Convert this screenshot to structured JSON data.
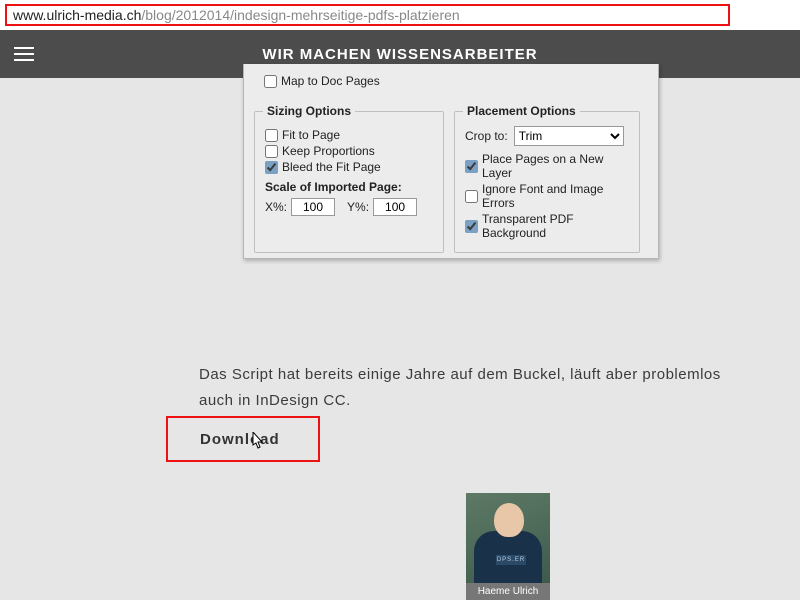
{
  "url": {
    "domain": "www.ulrich-media.ch",
    "path": "/blog/2012014/indesign-mehrseitige-pdfs-platzieren"
  },
  "header": {
    "title": "WIR MACHEN WISSENSARBEITER"
  },
  "dialog": {
    "map_to_doc_pages": {
      "label": "Map to Doc Pages",
      "checked": false
    },
    "sizing": {
      "legend": "Sizing Options",
      "fit_to_page": {
        "label": "Fit to Page",
        "checked": false
      },
      "keep_proportions": {
        "label": "Keep Proportions",
        "checked": false
      },
      "bleed_fit_page": {
        "label": "Bleed the Fit Page",
        "checked": true
      },
      "scale_label": "Scale of Imported Page:",
      "x_label": "X%:",
      "x_value": "100",
      "y_label": "Y%:",
      "y_value": "100"
    },
    "placement": {
      "legend": "Placement Options",
      "crop_label": "Crop to:",
      "crop_value": "Trim",
      "new_layer": {
        "label": "Place Pages on a New Layer",
        "checked": true
      },
      "ignore_errors": {
        "label": "Ignore Font and Image Errors",
        "checked": false
      },
      "transparent_bg": {
        "label": "Transparent PDF Background",
        "checked": true
      }
    }
  },
  "article": {
    "body_text": "Das Script hat bereits einige Jahre auf dem Buckel, läuft aber problemlos auch in InDesign CC.",
    "download_label": "Download"
  },
  "author": {
    "name": "Haeme Ulrich",
    "shirt_patch": "DPS.ER"
  }
}
